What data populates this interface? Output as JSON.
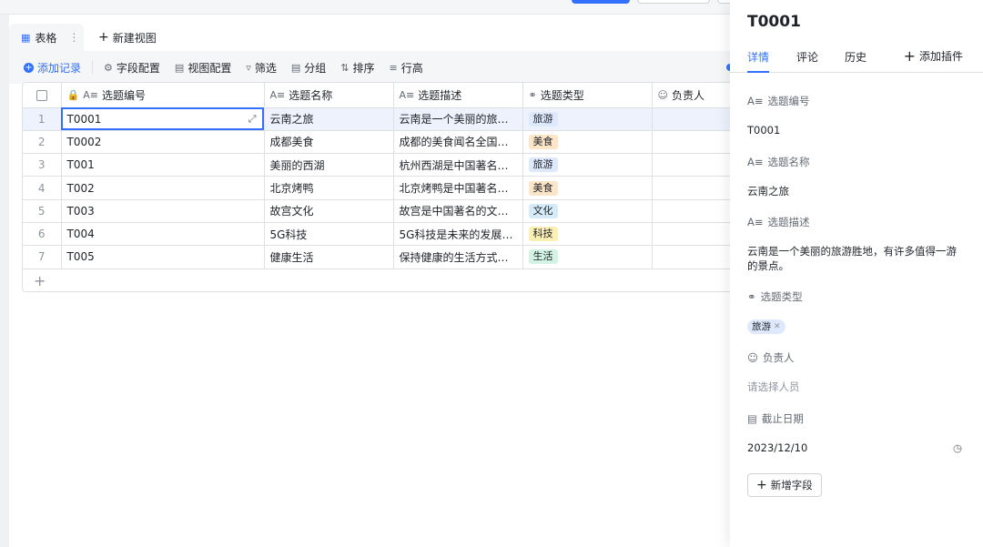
{
  "view": {
    "tab_label": "表格",
    "new_view_label": "新建视图"
  },
  "toolbar": {
    "add_record": "添加记录",
    "field_config": "字段配置",
    "view_config": "视图配置",
    "filter": "筛选",
    "group": "分组",
    "sort": "排序",
    "row_height": "行高"
  },
  "table": {
    "columns": [
      "选题编号",
      "选题名称",
      "选题描述",
      "选题类型",
      "负责人"
    ],
    "rows": [
      {
        "num": "1",
        "id": "T0001",
        "name": "云南之旅",
        "desc": "云南是一个美丽的旅游...",
        "type": "旅游",
        "type_color": "#dfe9fe"
      },
      {
        "num": "2",
        "id": "T0002",
        "name": "成都美食",
        "desc": "成都的美食闻名全国，...",
        "type": "美食",
        "type_color": "#fde5c8"
      },
      {
        "num": "3",
        "id": "T001",
        "name": "美丽的西湖",
        "desc": "杭州西湖是中国著名的...",
        "type": "旅游",
        "type_color": "#dfe9fe"
      },
      {
        "num": "4",
        "id": "T002",
        "name": "北京烤鸭",
        "desc": "北京烤鸭是中国著名的...",
        "type": "美食",
        "type_color": "#fde5c8"
      },
      {
        "num": "5",
        "id": "T003",
        "name": "故宫文化",
        "desc": "故宫是中国著名的文化...",
        "type": "文化",
        "type_color": "#d5ecf8"
      },
      {
        "num": "6",
        "id": "T004",
        "name": "5G科技",
        "desc": "5G科技是未来的发展方...",
        "type": "科技",
        "type_color": "#fcefb4"
      },
      {
        "num": "7",
        "id": "T005",
        "name": "健康生活",
        "desc": "保持健康的生活方式是...",
        "type": "生活",
        "type_color": "#d3f3e4"
      }
    ]
  },
  "panel": {
    "title": "T0001",
    "tabs": [
      "详情",
      "评论",
      "历史"
    ],
    "add_plugin": "添加插件",
    "fields": {
      "id_label": "选题编号",
      "id_value": "T0001",
      "name_label": "选题名称",
      "name_value": "云南之旅",
      "desc_label": "选题描述",
      "desc_value": "云南是一个美丽的旅游胜地，有许多值得一游的景点。",
      "type_label": "选题类型",
      "type_value": "旅游",
      "owner_label": "负责人",
      "owner_placeholder": "请选择人员",
      "date_label": "截止日期",
      "date_value": "2023/12/10"
    },
    "new_field": "新增字段"
  },
  "colors": {
    "accent": "#3370ff",
    "tag_travel": "#dfe9fe",
    "tag_food": "#fde5c8",
    "tag_culture": "#d5ecf8",
    "tag_tech": "#fcefb4",
    "tag_life": "#d3f3e4"
  }
}
